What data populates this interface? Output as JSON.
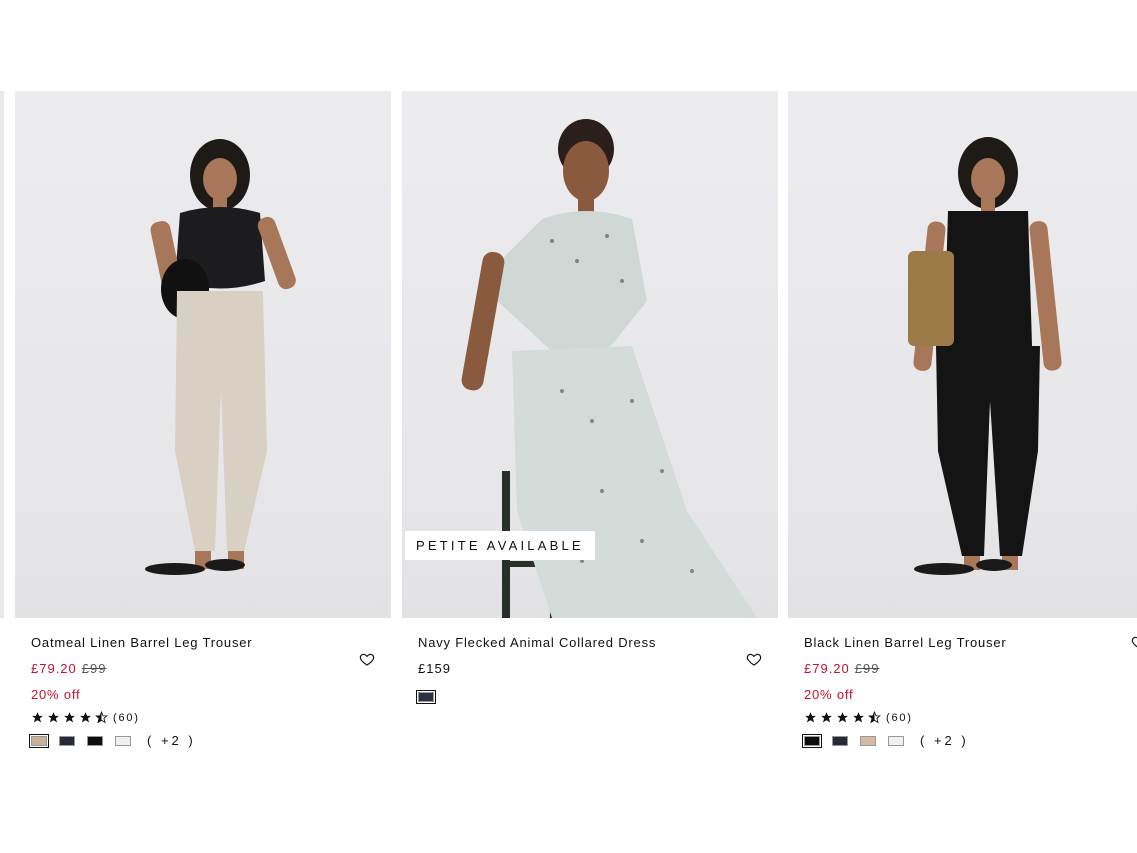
{
  "products": [
    {
      "title": "Oatmeal Linen Barrel Leg Trouser",
      "price_now": "£79.20",
      "price_was": "£99",
      "discount": "20% off",
      "rating": 4.5,
      "review_count": "(60)",
      "badge": "",
      "swatches": [
        "#c8b29b",
        "#262a36",
        "#0d0d0d",
        "#efefef"
      ],
      "more_colours": "( +2 )",
      "image_icon": "model-photo-icon"
    },
    {
      "title": "Navy Flecked Animal Collared Dress",
      "price": "£159",
      "badge": "PETITE AVAILABLE",
      "swatches": [
        "#2a3142"
      ],
      "image_icon": "model-photo-icon"
    },
    {
      "title": "Black Linen Barrel Leg Trouser",
      "price_now": "£79.20",
      "price_was": "£99",
      "discount": "20% off",
      "rating": 4.5,
      "review_count": "(60)",
      "badge": "",
      "swatches": [
        "#0d0d0d",
        "#262a36",
        "#d5b9a1",
        "#efefef"
      ],
      "more_colours": "( +2 )",
      "image_icon": "model-photo-icon"
    }
  ],
  "colors": {
    "sale_red": "#c8102e",
    "text": "#111111"
  },
  "icons": {
    "wishlist": "heart-outline-icon",
    "star_full": "star-icon",
    "star_half": "star-half-icon"
  }
}
